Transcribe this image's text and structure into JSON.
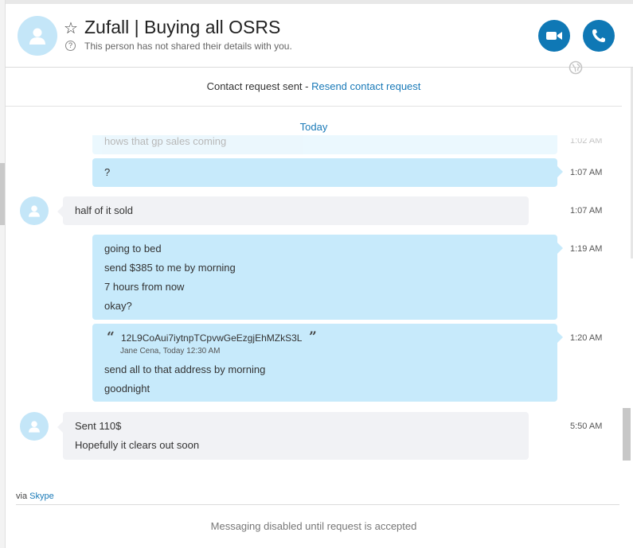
{
  "header": {
    "title": "Zufall | Buying all OSRS",
    "subtitle": "This person has not shared their details with you."
  },
  "request_bar": {
    "text": "Contact request sent - ",
    "link": "Resend contact request"
  },
  "date_divider": "Today",
  "messages": [
    {
      "id": "m0",
      "direction": "out",
      "lines": [
        "hows that gp sales coming"
      ],
      "time": "1:02 AM"
    },
    {
      "id": "m1",
      "direction": "out",
      "lines": [
        "?"
      ],
      "time": "1:07 AM"
    },
    {
      "id": "m2",
      "direction": "in",
      "lines": [
        "half of it sold"
      ],
      "time": "1:07 AM"
    },
    {
      "id": "m3",
      "direction": "out",
      "lines": [
        "going to bed",
        "send $385 to me by morning",
        "7 hours from now",
        "okay?"
      ],
      "time": "1:19 AM"
    },
    {
      "id": "m4",
      "direction": "out",
      "quote": {
        "text": "12L9CoAui7iytnpTCpvwGeEzgjEhMZkS3L",
        "meta": "Jane Cena, Today 12:30 AM"
      },
      "lines": [
        "send all to that address by morning",
        "goodnight"
      ],
      "time": "1:20 AM"
    },
    {
      "id": "m5",
      "direction": "in",
      "lines": [
        "Sent 110$",
        "Hopefully it clears out soon"
      ],
      "time": "5:50 AM"
    }
  ],
  "via": {
    "prefix": "via ",
    "link": "Skype"
  },
  "footer": "Messaging disabled until request is accepted",
  "colors": {
    "accent": "#0f78b5",
    "outgoing_bubble": "#c7eafb",
    "incoming_bubble": "#f1f2f5",
    "avatar_bg": "#c4e6f8",
    "link": "#1a7ab8"
  },
  "icons": [
    "star-icon",
    "info-icon",
    "video-call-icon",
    "phone-icon",
    "globe-icon",
    "avatar-icon",
    "quote-icon"
  ]
}
